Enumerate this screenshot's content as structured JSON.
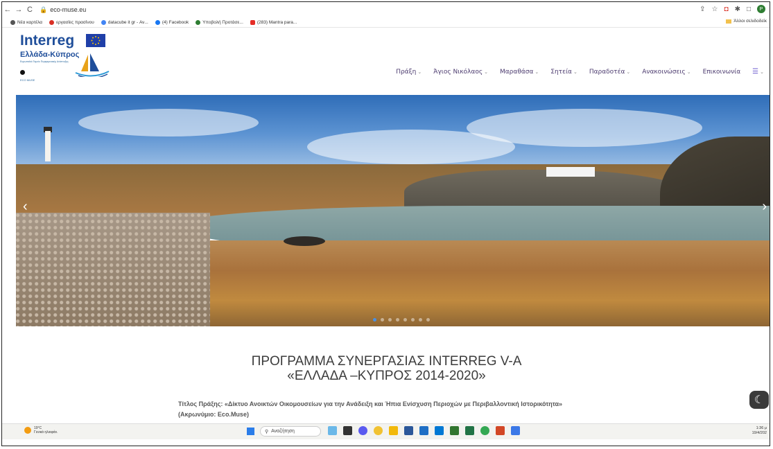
{
  "browser": {
    "url": "eco-muse.eu",
    "profile_initial": "P"
  },
  "bookmarks": {
    "items": [
      {
        "label": "Νέα καρτέλα",
        "color": "#555555"
      },
      {
        "label": "εργασίες πρασίνου",
        "color": "#d93025"
      },
      {
        "label": "datacube it gr - Αν...",
        "color": "#4285f4"
      },
      {
        "label": "(4) Facebook",
        "color": "#1877f2"
      },
      {
        "label": "Υποβολή Προτάσε...",
        "color": "#2e7d32"
      },
      {
        "label": "(283) Mantra para...",
        "color": "#e52d27"
      }
    ],
    "other": "Άλλοι σελιδοδείκ"
  },
  "logo": {
    "title": "Interreg",
    "subtitle": "Ελλάδα-Κύπρος",
    "tiny": "Ευρωπαϊκό Ταμείο Περιφερειακής Ανάπτυξης",
    "eco": "ECO MUSE"
  },
  "menu": [
    {
      "label": "Πράξη",
      "chevron": true
    },
    {
      "label": "Άγιος Νικόλαος",
      "chevron": true
    },
    {
      "label": "Μαραθάσα",
      "chevron": true
    },
    {
      "label": "Σητεία",
      "chevron": true
    },
    {
      "label": "Παραδοτέα",
      "chevron": true
    },
    {
      "label": "Ανακοινώσεις",
      "chevron": true
    },
    {
      "label": "Επικοινωνία",
      "chevron": false
    }
  ],
  "hero": {
    "prev": "‹",
    "next": "›",
    "slides": 8,
    "active": 0
  },
  "content": {
    "title_line1": "ΠΡΟΓΡΑΜΜΑ ΣΥΝΕΡΓΑΣΙΑΣ INTERREG V-A",
    "title_line2": "«ΕΛΛΑΔΑ –ΚΥΠΡΟΣ 2014-2020»",
    "text_line1": "Τίτλος Πράξης: «Δίκτυο Ανοικτών Οικομουσείων για την Ανάδειξη και Ήπια Ενίσχυση Περιοχών με Περιβαλλοντική Ιστορικότητα»",
    "text_line2": "(Ακρωνύμιο: Eco.Muse)"
  },
  "taskbar": {
    "temp": "19°C",
    "weather": "Γενικά ηλιοφάν.",
    "search": "Αναζήτηση",
    "time": "1:36 μ",
    "date": "19/4/202"
  }
}
